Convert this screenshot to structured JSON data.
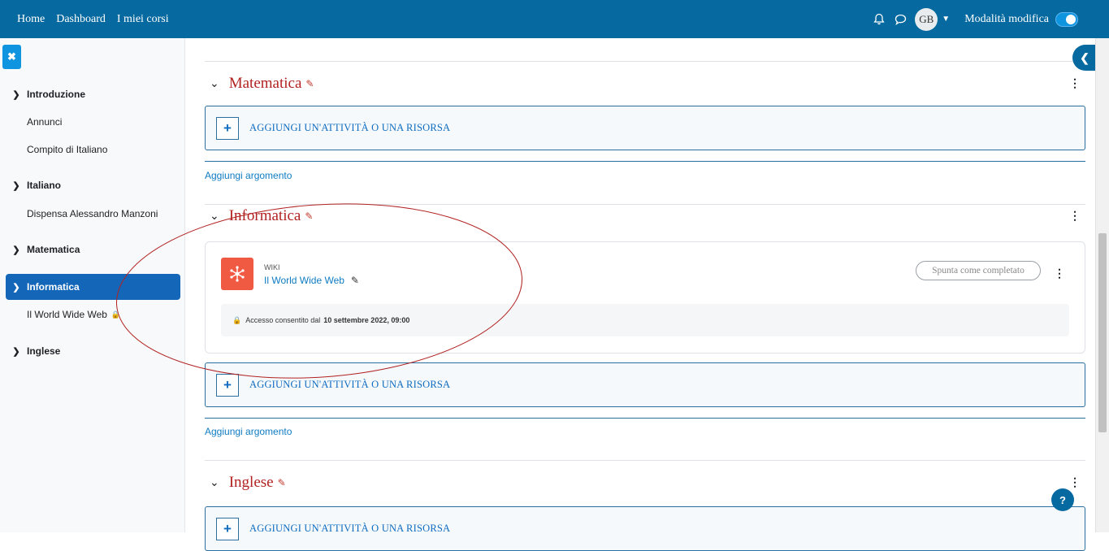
{
  "navbar": {
    "links": [
      "Home",
      "Dashboard",
      "I miei corsi"
    ],
    "user_initials": "GB",
    "edit_mode_label": "Modalità modifica",
    "edit_mode_on": true
  },
  "drawer": {
    "items": [
      {
        "label": "Introduzione",
        "type": "section"
      },
      {
        "label": "Annunci",
        "type": "sub"
      },
      {
        "label": "Compito di Italiano",
        "type": "sub"
      },
      {
        "label": "Italiano",
        "type": "section"
      },
      {
        "label": "Dispensa Alessandro Manzoni",
        "type": "sub"
      },
      {
        "label": "Matematica",
        "type": "section"
      },
      {
        "label": "Informatica",
        "type": "section",
        "active": true
      },
      {
        "label": "Il World Wide Web",
        "type": "sub",
        "locked": true
      },
      {
        "label": "Inglese",
        "type": "section"
      }
    ]
  },
  "main": {
    "sections": [
      {
        "title": "Matematica"
      },
      {
        "title": "Informatica"
      },
      {
        "title": "Inglese"
      }
    ],
    "add_activity_label": "AGGIUNGI UN'ATTIVITÀ O UNA RISORSA",
    "add_topic_label": "Aggiungi argomento",
    "activity": {
      "type": "WIKI",
      "name": "Il World Wide Web",
      "complete_label": "Spunta come completato",
      "restriction_prefix": "Accesso consentito dal",
      "restriction_date": "10 settembre 2022, 09:00"
    }
  },
  "colors": {
    "navbar": "#06699f",
    "section_title": "#b22222",
    "link": "#0f7cc2",
    "wiki_icon": "#f05a43",
    "active_drawer": "#1366b8"
  }
}
